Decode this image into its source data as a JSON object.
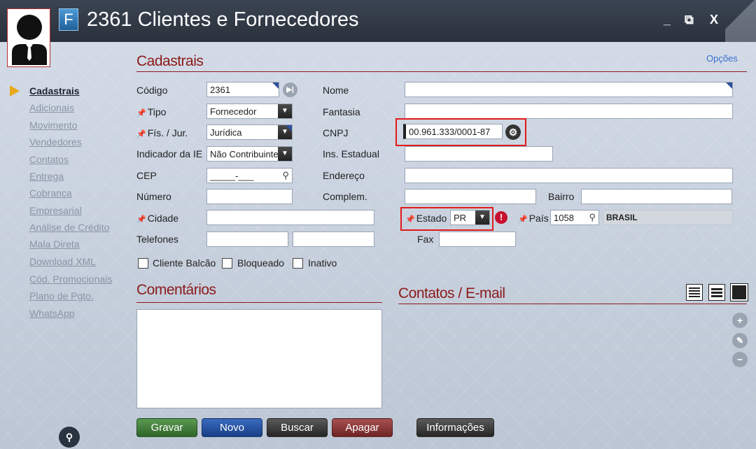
{
  "window": {
    "app_badge": "F",
    "title": "2361 Clientes e Fornecedores",
    "minimize": "_",
    "restore": "⧉",
    "close": "X"
  },
  "options_link": "Opções",
  "sidebar": {
    "items": [
      {
        "label": "Cadastrais",
        "active": true
      },
      {
        "label": "Adicionais"
      },
      {
        "label": "Movimento"
      },
      {
        "label": "Vendedores"
      },
      {
        "label": "Contatos"
      },
      {
        "label": "Entrega"
      },
      {
        "label": "Cobrança"
      },
      {
        "label": "Empresarial"
      },
      {
        "label": "Análise de Crédito"
      },
      {
        "label": "Mala Direta"
      },
      {
        "label": "Download XML"
      },
      {
        "label": "Cód. Promocionais"
      },
      {
        "label": "Plano de Pgto."
      },
      {
        "label": "WhatsApp"
      }
    ]
  },
  "sections": {
    "cadastrais": "Cadastrais",
    "comentarios": "Comentários",
    "contatos": "Contatos / E-mail"
  },
  "form": {
    "codigo": {
      "label": "Código",
      "value": "2361"
    },
    "tipo": {
      "label": "Tipo",
      "value": "Fornecedor"
    },
    "fis_jur": {
      "label": "Fís. / Jur.",
      "value": "Jurídica"
    },
    "indicador_ie": {
      "label": "Indicador da IE",
      "value": "Não Contribuinte"
    },
    "cep": {
      "label": "CEP",
      "value": "_____-___"
    },
    "numero": {
      "label": "Número",
      "value": ""
    },
    "cidade": {
      "label": "Cidade",
      "value": ""
    },
    "telefones": {
      "label": "Telefones",
      "value1": "",
      "value2": ""
    },
    "nome": {
      "label": "Nome",
      "value": ""
    },
    "fantasia": {
      "label": "Fantasia",
      "value": ""
    },
    "cnpj": {
      "label": "CNPJ",
      "value": "00.961.333/0001-87"
    },
    "ins_estadual": {
      "label": "Ins. Estadual",
      "value": ""
    },
    "endereco": {
      "label": "Endereço",
      "value": ""
    },
    "complem": {
      "label": "Complem.",
      "value": ""
    },
    "bairro": {
      "label": "Bairro",
      "value": ""
    },
    "estado": {
      "label": "Estado",
      "value": "PR"
    },
    "pais": {
      "label": "País",
      "code": "1058",
      "name": "BRASIL"
    },
    "fax": {
      "label": "Fax",
      "value": ""
    }
  },
  "checkboxes": [
    {
      "label": "Cliente Balcão",
      "checked": false
    },
    {
      "label": "Bloqueado",
      "checked": false
    },
    {
      "label": "Inativo",
      "checked": false
    }
  ],
  "buttons": {
    "gravar": "Gravar",
    "novo": "Novo",
    "buscar": "Buscar",
    "apagar": "Apagar",
    "informacoes": "Informações"
  },
  "colors": {
    "accent_red": "#8b1a1a",
    "highlight_box": "#e11a1a",
    "gravar": "#3f7a3a",
    "novo": "#1f4c9a",
    "buscar": "#3a3a3a",
    "apagar": "#8a2e2e"
  }
}
